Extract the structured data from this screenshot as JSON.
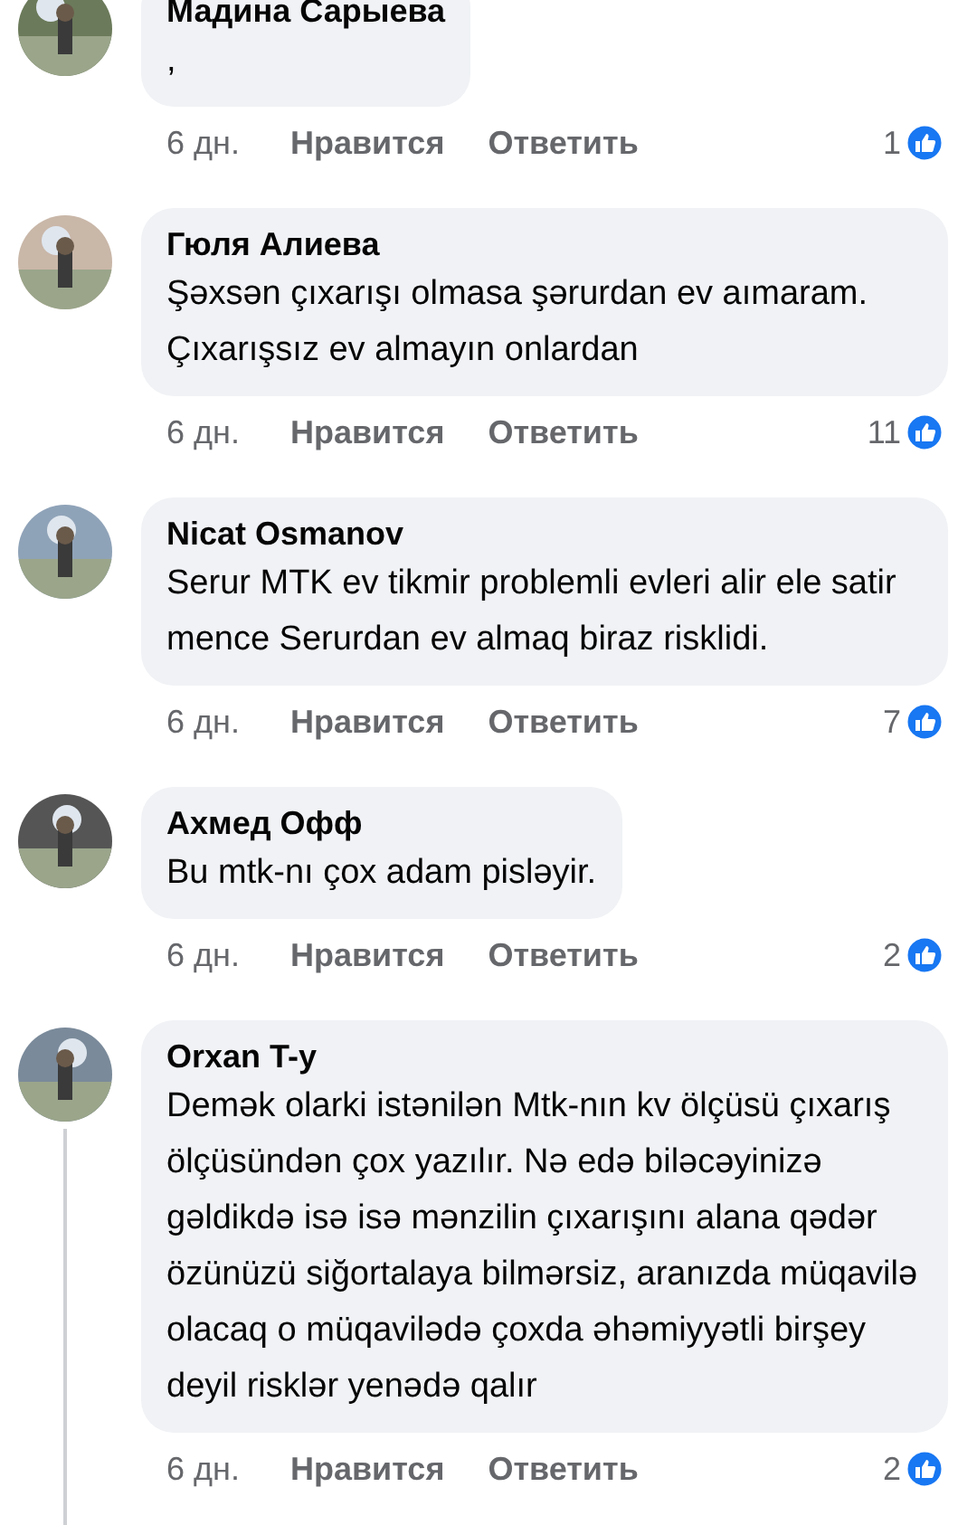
{
  "comments": [
    {
      "name": "Мадина Сарыева",
      "text": ",",
      "time": "6 дн.",
      "like": "Нравится",
      "reply": "Ответить",
      "count": "1",
      "thread": false
    },
    {
      "name": "Гюля Алиева",
      "text": "Şəxsən çıxarışı olmasa şərurdan ev aımaram. Çıxarışsız ev almayın onlardan",
      "time": "6 дн.",
      "like": "Нравится",
      "reply": "Ответить",
      "count": "11",
      "thread": false
    },
    {
      "name": "Nicat Osmanov",
      "text": "Serur MTK ev tikmir problemli evleri alir ele satir mence Serurdan ev almaq biraz risklidi.",
      "time": "6 дн.",
      "like": "Нравится",
      "reply": "Ответить",
      "count": "7",
      "thread": false
    },
    {
      "name": "Ахмед Офф",
      "text": "Bu mtk-nı çox adam pisləyir.",
      "time": "6 дн.",
      "like": "Нравится",
      "reply": "Ответить",
      "count": "2",
      "thread": false
    },
    {
      "name": "Orxan T-y",
      "text": "Demək olarki istənilən Mtk-nın kv ölçüsü çıxarış ölçüsündən çox yazılır. Nə edə biləcəyinizə gəldikdə isə isə mənzilin çıxarışını alana qədər özünüzü siğortalaya bilmərsiz, aranızda müqavilə olacaq o müqavilədə çoxda əhəmiyyətli birşey deyil risklər yenədə qalır",
      "time": "6 дн.",
      "like": "Нравится",
      "reply": "Ответить",
      "count": "2",
      "thread": true
    }
  ]
}
